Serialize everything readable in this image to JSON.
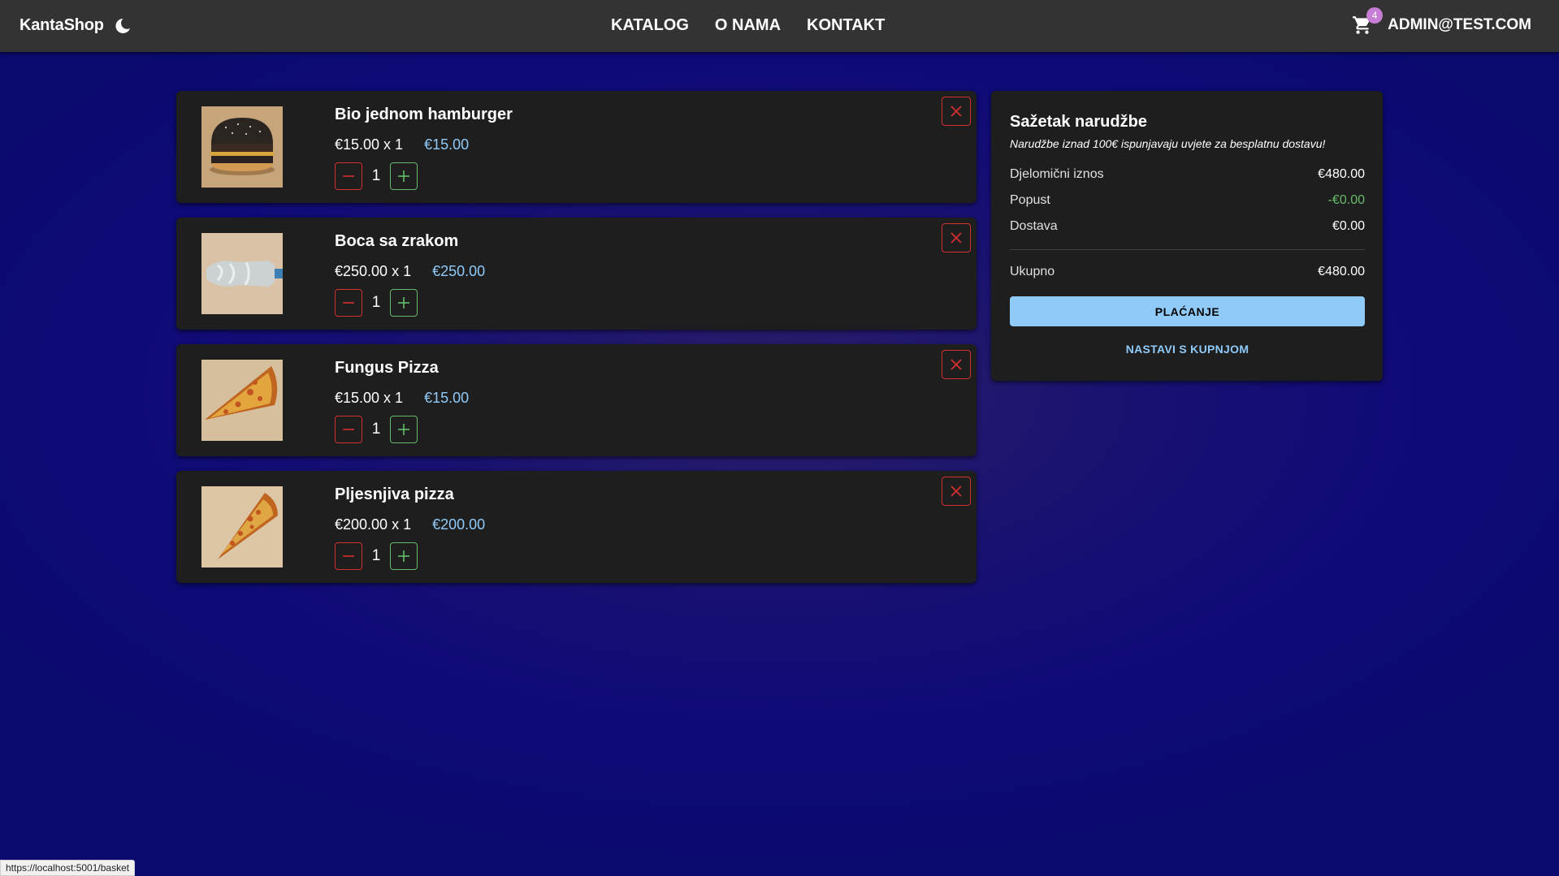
{
  "header": {
    "brand": "KantaShop",
    "nav": [
      "KATALOG",
      "O NAMA",
      "KONTAKT"
    ],
    "cart_count": "4",
    "user": "ADMIN@TEST.COM"
  },
  "basket": {
    "items": [
      {
        "name": "Bio jednom hamburger",
        "unit": "€15.00 x 1",
        "total": "€15.00",
        "qty": "1",
        "image": "burger"
      },
      {
        "name": "Boca sa zrakom",
        "unit": "€250.00 x 1",
        "total": "€250.00",
        "qty": "1",
        "image": "bottle"
      },
      {
        "name": "Fungus Pizza",
        "unit": "€15.00 x 1",
        "total": "€15.00",
        "qty": "1",
        "image": "pizza-slice"
      },
      {
        "name": "Pljesnjiva pizza",
        "unit": "€200.00 x 1",
        "total": "€200.00",
        "qty": "1",
        "image": "pizza-slice"
      }
    ]
  },
  "summary": {
    "title": "Sažetak narudžbe",
    "note": "Narudžbe iznad 100€ ispunjavaju uvjete za besplatnu dostavu!",
    "subtotal_label": "Djelomični iznos",
    "subtotal_value": "€480.00",
    "discount_label": "Popust",
    "discount_value": "-€0.00",
    "shipping_label": "Dostava",
    "shipping_value": "€0.00",
    "total_label": "Ukupno",
    "total_value": "€480.00",
    "checkout_label": "PLAĆANJE",
    "continue_label": "NASTAVI S KUPNJOM"
  },
  "status_bar": {
    "url": "https://localhost:5001/basket"
  },
  "colors": {
    "accent": "#90caf9",
    "danger": "#d32f2f",
    "success": "#66bb6a",
    "badge": "#c77dd6"
  }
}
